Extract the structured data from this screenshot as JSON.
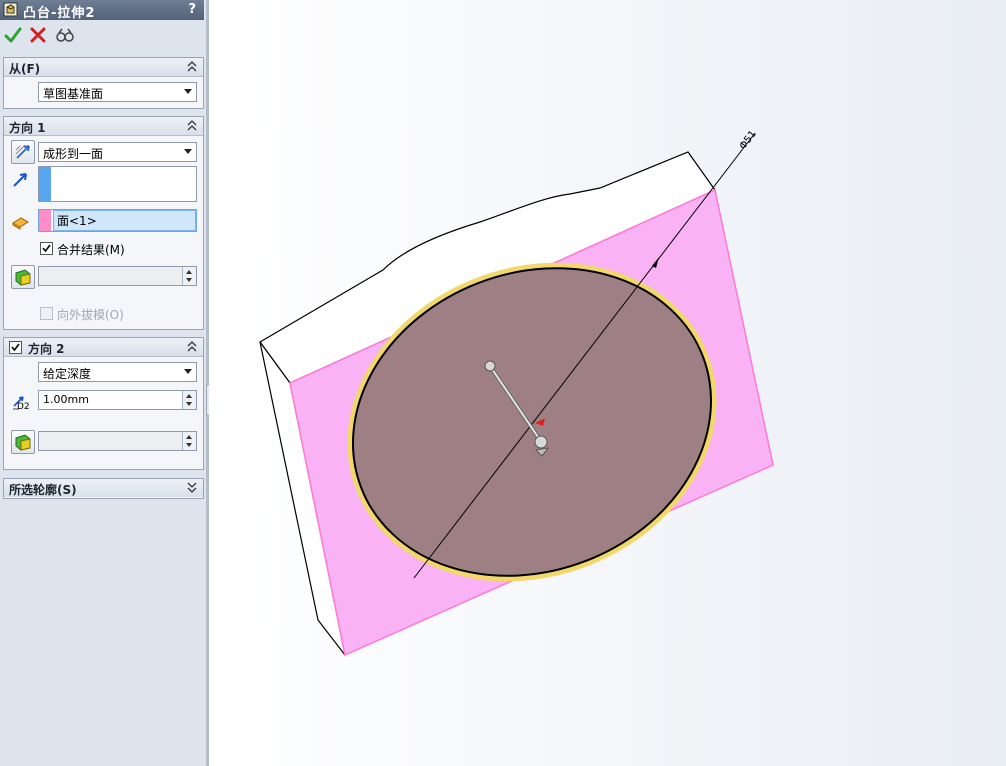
{
  "window": {
    "title": "凸台-拉伸2",
    "help_label": "?"
  },
  "actions": {
    "ok": "ok-checkmark-icon",
    "cancel": "cancel-x-icon",
    "preview": "detailed-preview-icon"
  },
  "from_section": {
    "header": "从(F)",
    "start_condition": "草图基准面"
  },
  "direction1": {
    "header": "方向 1",
    "end_condition": "成形到一面",
    "direction_vector": "",
    "face": "面<1>",
    "merge_result": {
      "label": "合并结果(M)",
      "checked": true
    },
    "draft_value": "",
    "draft_outward": {
      "label": "向外拔模(O)",
      "checked": false,
      "enabled": false
    }
  },
  "direction2": {
    "header": "方向 2",
    "checked": true,
    "end_condition": "给定深度",
    "depth_value": "1.00mm",
    "depth_icon_label": "D2",
    "draft_value": ""
  },
  "selected_contours": {
    "header": "所选轮廓(S)"
  },
  "dimension": {
    "label": "Φ51"
  },
  "colors": {
    "accent_blue": "#5aa5f0",
    "face_pink": "#ff99dd",
    "face_fill": "#f9b3f5",
    "circle_fill": "#9e8084",
    "ok_green": "#2ea12e",
    "cancel_red": "#d02020"
  }
}
